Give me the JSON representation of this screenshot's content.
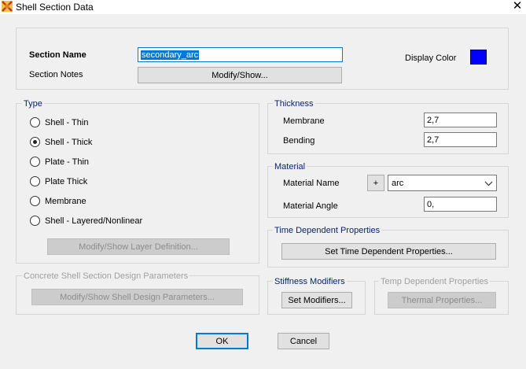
{
  "window": {
    "title": "Shell Section Data",
    "close_glyph": "✕",
    "icon": "app-icon"
  },
  "section": {
    "name_label": "Section Name",
    "name_value": "secondary_arc",
    "notes_label": "Section Notes",
    "notes_button": "Modify/Show...",
    "display_color_label": "Display Color",
    "display_color": "#0000ff"
  },
  "type": {
    "title": "Type",
    "options": [
      "Shell - Thin",
      "Shell - Thick",
      "Plate - Thin",
      "Plate Thick",
      "Membrane",
      "Shell - Layered/Nonlinear"
    ],
    "selected": "Shell - Thick",
    "layer_button": "Modify/Show Layer Definition..."
  },
  "thickness": {
    "title": "Thickness",
    "membrane_label": "Membrane",
    "membrane_value": "2,7",
    "bending_label": "Bending",
    "bending_value": "2,7"
  },
  "material": {
    "title": "Material",
    "name_label": "Material Name",
    "add_button": "+",
    "name_value": "arc",
    "angle_label": "Material Angle",
    "angle_value": "0,"
  },
  "time_dependent": {
    "title": "Time Dependent Properties",
    "button": "Set Time Dependent Properties..."
  },
  "concrete": {
    "title": "Concrete Shell Section Design Parameters",
    "button": "Modify/Show Shell Design Parameters..."
  },
  "stiffness": {
    "title": "Stiffness Modifiers",
    "button": "Set Modifiers..."
  },
  "temp": {
    "title": "Temp Dependent Properties",
    "button": "Thermal Properties..."
  },
  "footer": {
    "ok": "OK",
    "cancel": "Cancel"
  }
}
